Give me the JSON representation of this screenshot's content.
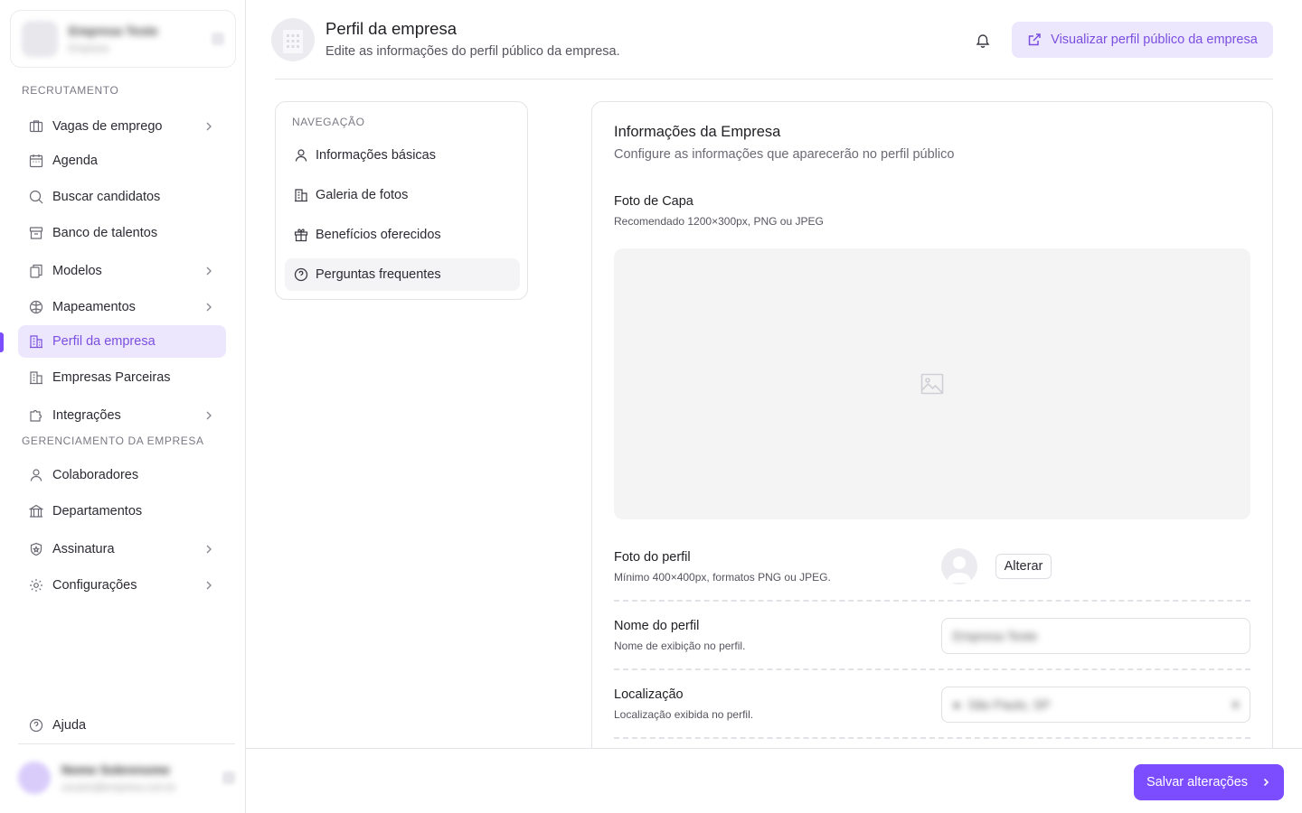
{
  "sidebar": {
    "org": {
      "name": "Empresa Teste",
      "subtitle": "Empresa"
    },
    "sections": {
      "recruitment": "RECRUTAMENTO",
      "management": "GERENCIAMENTO DA EMPRESA"
    },
    "items": [
      {
        "label": "Vagas de emprego",
        "icon": "briefcase-icon"
      },
      {
        "label": "Agenda",
        "icon": "calendar-icon"
      },
      {
        "label": "Buscar candidatos",
        "icon": "search-icon"
      },
      {
        "label": "Banco de talentos",
        "icon": "archive-icon"
      },
      {
        "label": "Modelos",
        "icon": "copy-icon"
      },
      {
        "label": "Mapeamentos",
        "icon": "brain-icon"
      },
      {
        "label": "Perfil da empresa",
        "icon": "building-icon"
      },
      {
        "label": "Empresas Parceiras",
        "icon": "building-icon"
      },
      {
        "label": "Integrações",
        "icon": "puzzle-icon"
      },
      {
        "label": "Colaboradores",
        "icon": "user-icon"
      },
      {
        "label": "Departamentos",
        "icon": "bank-icon"
      },
      {
        "label": "Assinatura",
        "icon": "shield-icon"
      },
      {
        "label": "Configurações",
        "icon": "gear-icon"
      },
      {
        "label": "Ajuda",
        "icon": "help-icon"
      }
    ],
    "user": {
      "name": "Nome Sobrenome",
      "email": "usuario@empresa.com.br"
    }
  },
  "header": {
    "title": "Perfil da empresa",
    "subtitle": "Edite as informações do perfil público da empresa.",
    "view_public_label": "Visualizar perfil público da empresa"
  },
  "subnav": {
    "label": "NAVEGAÇÃO",
    "items": [
      {
        "label": "Informações básicas",
        "icon": "user-icon"
      },
      {
        "label": "Galeria de fotos",
        "icon": "building-icon"
      },
      {
        "label": "Benefícios oferecidos",
        "icon": "gift-icon"
      },
      {
        "label": "Perguntas frequentes",
        "icon": "help-icon"
      }
    ]
  },
  "main": {
    "title": "Informações da Empresa",
    "subtitle": "Configure as informações que aparecerão no perfil público",
    "cover": {
      "label": "Foto de Capa",
      "hint": "Recomendado 1200×300px, PNG ou JPEG"
    },
    "profile_photo": {
      "label": "Foto do perfil",
      "hint": "Mínimo 400×400px, formatos PNG ou JPEG.",
      "button": "Alterar"
    },
    "profile_name": {
      "label": "Nome do perfil",
      "hint": "Nome de exibição no perfil.",
      "value": "Empresa Teste"
    },
    "location": {
      "label": "Localização",
      "hint": "Localização exibida no perfil.",
      "value": "São Paulo, SP"
    }
  },
  "footer": {
    "save_label": "Salvar alterações"
  },
  "colors": {
    "accent": "#7c4dff",
    "accent_soft": "#ede7fd",
    "accent_text": "#7a4fe0"
  }
}
